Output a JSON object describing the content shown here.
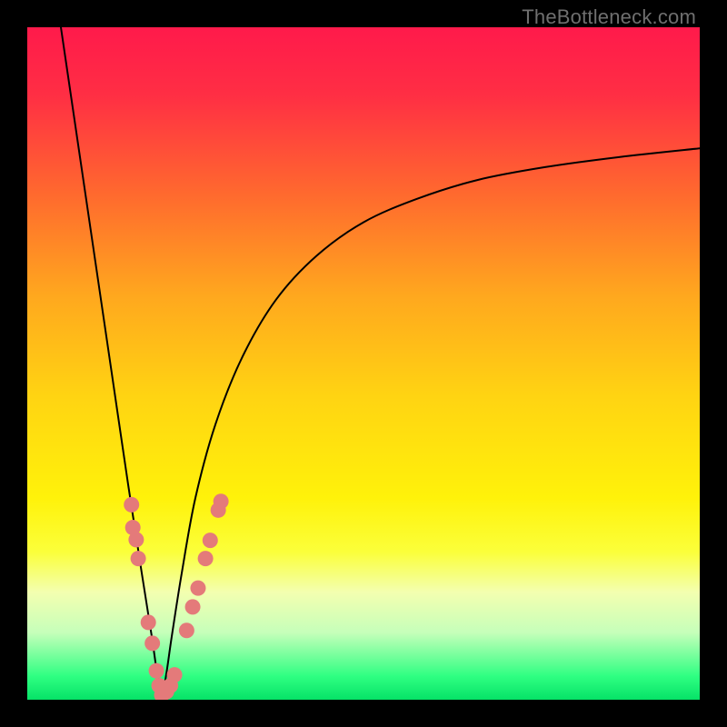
{
  "watermark": "TheBottleneck.com",
  "colors": {
    "gradient_stops": [
      {
        "offset": 0.0,
        "color": "#ff1a4b"
      },
      {
        "offset": 0.1,
        "color": "#ff2e44"
      },
      {
        "offset": 0.25,
        "color": "#ff6a2e"
      },
      {
        "offset": 0.4,
        "color": "#ffa81e"
      },
      {
        "offset": 0.55,
        "color": "#ffd412"
      },
      {
        "offset": 0.7,
        "color": "#fff20a"
      },
      {
        "offset": 0.78,
        "color": "#fbff3a"
      },
      {
        "offset": 0.84,
        "color": "#f3ffb0"
      },
      {
        "offset": 0.9,
        "color": "#c6ffba"
      },
      {
        "offset": 0.965,
        "color": "#2fff82"
      },
      {
        "offset": 1.0,
        "color": "#06e267"
      }
    ],
    "curve_stroke": "#000000",
    "marker_fill": "#e47a7a",
    "marker_stroke": "#c65e5e",
    "frame_bg": "#000000"
  },
  "chart_data": {
    "type": "line",
    "title": "",
    "xlabel": "",
    "ylabel": "",
    "xlim": [
      0,
      100
    ],
    "ylim": [
      0,
      100
    ],
    "legend": false,
    "grid": false,
    "notes": "No axis tick labels are visible in the image; minimum of the V-curve near x≈20; right branch asymptotes to ~y≈82 at x=100. Values are read from the rendered curve at the plotting-implied precision.",
    "series": [
      {
        "name": "bottleneck_curve",
        "x": [
          5,
          7.5,
          10,
          12.5,
          15,
          17,
          18.5,
          19.3,
          20,
          20.7,
          21.5,
          23,
          25,
          28,
          32,
          37,
          43,
          50,
          58,
          67,
          77,
          88,
          100
        ],
        "y": [
          100,
          83,
          66,
          49,
          32,
          19,
          9.5,
          4,
          0.5,
          4,
          9.5,
          19,
          30,
          41,
          51,
          59.5,
          66,
          71,
          74.5,
          77.3,
          79.2,
          80.7,
          82
        ]
      }
    ],
    "markers": {
      "name": "highlight_dots",
      "points": [
        {
          "x": 15.5,
          "y": 29
        },
        {
          "x": 15.7,
          "y": 25.6
        },
        {
          "x": 16.2,
          "y": 23.8
        },
        {
          "x": 16.5,
          "y": 21
        },
        {
          "x": 18,
          "y": 11.5
        },
        {
          "x": 18.6,
          "y": 8.4
        },
        {
          "x": 19.2,
          "y": 4.3
        },
        {
          "x": 19.6,
          "y": 2.1
        },
        {
          "x": 20,
          "y": 0.7
        },
        {
          "x": 20.7,
          "y": 1.2
        },
        {
          "x": 21.3,
          "y": 2.1
        },
        {
          "x": 21.9,
          "y": 3.7
        },
        {
          "x": 23.7,
          "y": 10.3
        },
        {
          "x": 24.6,
          "y": 13.8
        },
        {
          "x": 25.4,
          "y": 16.6
        },
        {
          "x": 26.5,
          "y": 21
        },
        {
          "x": 27.2,
          "y": 23.7
        },
        {
          "x": 28.4,
          "y": 28.2
        },
        {
          "x": 28.8,
          "y": 29.5
        }
      ]
    }
  }
}
